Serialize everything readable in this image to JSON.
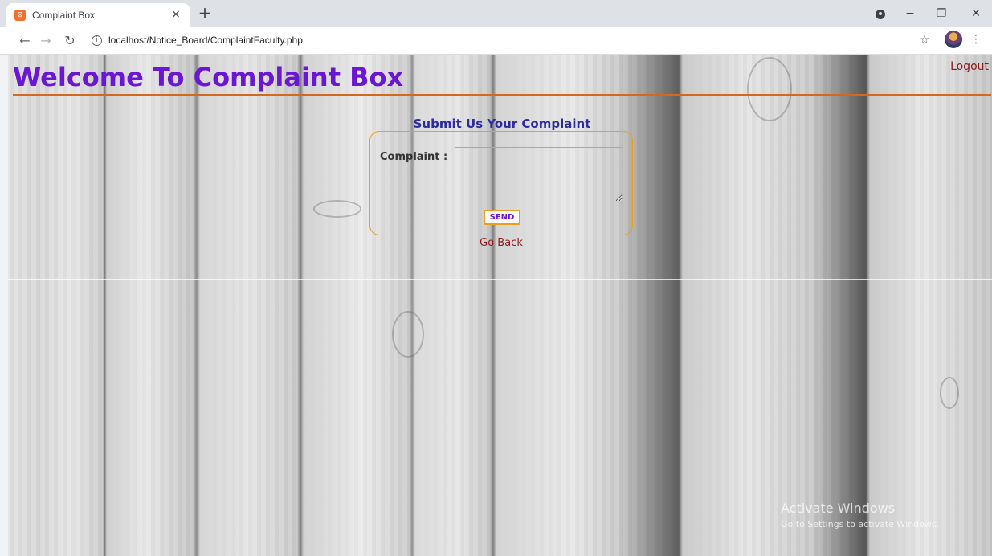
{
  "browser": {
    "tab_title": "Complaint Box",
    "tab_close": "×",
    "new_tab": "+",
    "url": "localhost/Notice_Board/ComplaintFaculty.php",
    "icons": {
      "favicon": "xampp-favicon-icon",
      "back": "arrow-left-icon",
      "forward": "arrow-right-icon",
      "reload": "reload-icon",
      "info": "info-icon",
      "bookmark": "star-icon",
      "profile": "profile-avatar-icon",
      "menu": "kebab-menu-icon",
      "record": "record-icon",
      "minimize": "minimize-icon",
      "maximize": "maximize-icon",
      "close": "close-icon"
    }
  },
  "page": {
    "title": "Welcome To Complaint Box",
    "logout_label": "Logout",
    "form_heading": "Submit Us Your Complaint",
    "complaint_label": "Complaint :",
    "complaint_value": "",
    "send_label": "SEND",
    "go_back_label": "Go Back",
    "colors": {
      "title": "#6a16d4",
      "heading": "#2c2ca0",
      "link": "#8b1a1a",
      "border": "#e8a020",
      "rule": "#d2691e"
    }
  },
  "watermark": {
    "title": "Activate Windows",
    "subtitle": "Go to Settings to activate Windows."
  }
}
